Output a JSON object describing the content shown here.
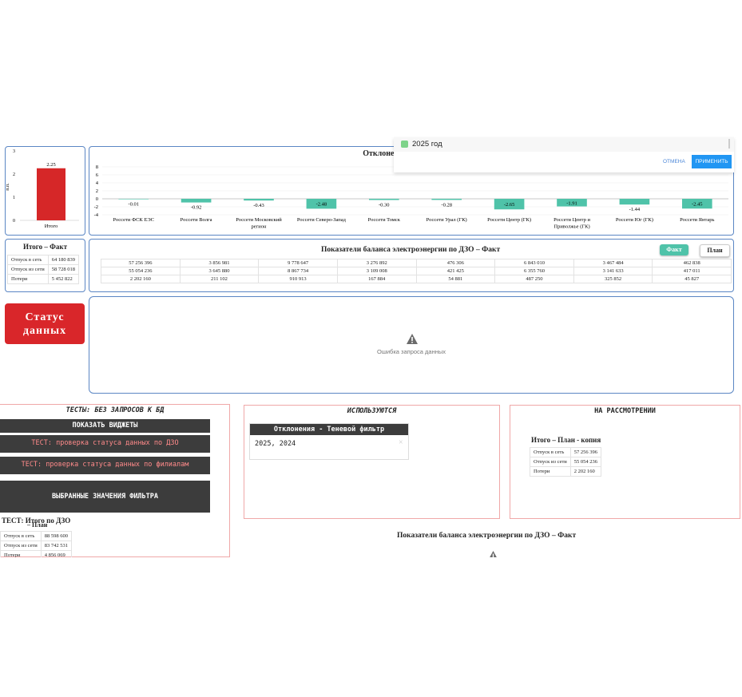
{
  "mini_chart": {
    "ylabel": "п.п.",
    "y_ticks": [
      "3",
      "2",
      "1",
      "0"
    ],
    "value_label": "2.25",
    "category": "Итого",
    "bar_color": "#d62728"
  },
  "deviation_chart": {
    "title": "Отклонения фактического",
    "y_ticks": [
      "8",
      "6",
      "4",
      "2",
      "0",
      "-2",
      "-4"
    ],
    "positive_color": "#4fc3a9"
  },
  "chart_data": {
    "type": "bar",
    "title": "Отклонения фактического",
    "ylabel": "",
    "ylim": [
      -4,
      8
    ],
    "categories": [
      "Россети ФСК ЕЭС",
      "Россети Волга",
      "Россети Московский регион",
      "Россети Северо-Запад",
      "Россети Томск",
      "Россети Урал (ГК)",
      "Россети Центр (ГК)",
      "Россети Центр и Приволжье (ГК)",
      "Россети Юг (ГК)",
      "Россети Янтарь"
    ],
    "values": [
      -0.01,
      -0.92,
      -0.43,
      -2.48,
      -0.3,
      -0.28,
      -2.65,
      -1.91,
      -1.44,
      -2.45
    ],
    "labels": [
      "-0.01",
      "-0.92",
      "-0.43",
      "-2.48",
      "-0.30",
      "-0.28",
      "-2.65",
      "-1.91",
      "-1.44",
      "-2.45"
    ]
  },
  "filter_popup": {
    "option_label": "2025 год",
    "option_color": "#7ed38a",
    "cancel_label": "ОТМЕНА",
    "apply_label": "ПРИМЕНИТЬ",
    "apply_color": "#2196f3"
  },
  "itogo_fact": {
    "title": "Итого – Факт",
    "rows": [
      {
        "label": "Отпуск в сеть",
        "value": "64 180 839"
      },
      {
        "label": "Отпуск из сети",
        "value": "58 728 018"
      },
      {
        "label": "Потери",
        "value": "5 452 822"
      }
    ]
  },
  "balance_fact": {
    "title": "Показатели баланса электроэнергии по ДЗО – Факт",
    "fact_label": "Факт",
    "plan_label": "План",
    "accent": "#4fc3a9",
    "rows": [
      [
        "57 256 396",
        "3 856 981",
        "9 778 647",
        "3 276 892",
        "476 306",
        "6 843 010",
        "3 467 484",
        "462 838"
      ],
      [
        "55 054 236",
        "3 645 880",
        "8 867 734",
        "3 109 008",
        "421 425",
        "6 355 760",
        "3 141 633",
        "417 011"
      ],
      [
        "2 202 160",
        "211 102",
        "910 913",
        "167 884",
        "54 881",
        "487 250",
        "325 852",
        "45 827"
      ]
    ]
  },
  "status_button": {
    "line1": "Статус",
    "line2": "данных",
    "color": "#d9262a"
  },
  "error_panel": {
    "message": "Ошибка запроса данных"
  },
  "tests_section": {
    "title": "ТЕСТЫ: БЕЗ ЗАПРОСОВ К БД",
    "show_widgets": "ПОКАЗАТЬ ВИДЖЕТЫ",
    "test_dzo": "ТЕСТ: проверка статуса данных по ДЗО",
    "test_branches": "ТЕСТ: проверка статуса данных по филиалам",
    "selected_filter": "ВЫБРАННЫЕ ЗНАЧЕНИЯ ФИЛЬТРА",
    "test_table_title": "ТЕСТ: Итого по ДЗО",
    "test_table_subtitle": "– План",
    "rows": [
      {
        "label": "Отпуск в сеть",
        "value": "88 598 600"
      },
      {
        "label": "Отпуск из сети",
        "value": "83 742 531"
      },
      {
        "label": "Потери",
        "value": "4 856 069"
      }
    ]
  },
  "used_section": {
    "title": "ИСПОЛЬЗУЮТСЯ",
    "shadow_filter_header": "Отклонения - Теневой фильтр",
    "shadow_filter_value": "2025, 2024"
  },
  "review_section": {
    "title": "НА РАССМОТРЕНИИ",
    "table_title": "Итого – План - копия",
    "rows": [
      {
        "label": "Отпуск в сеть",
        "value": "57 256 396"
      },
      {
        "label": "Отпуск из сети",
        "value": "55 054 236"
      },
      {
        "label": "Потери",
        "value": "2 202 160"
      }
    ]
  },
  "bottom_balance": {
    "title": "Показатели баланса электроэнергии по ДЗО – Факт"
  }
}
